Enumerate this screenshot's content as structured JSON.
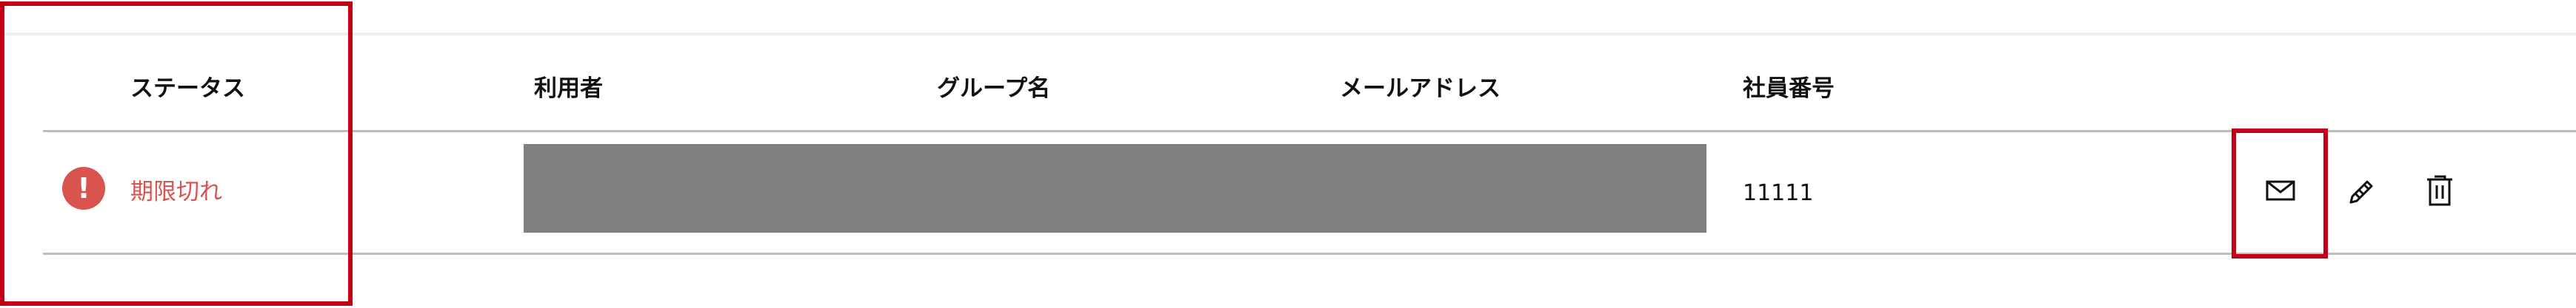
{
  "table": {
    "headers": [
      "ステータス",
      "利用者",
      "グループ名",
      "メールアドレス",
      "社員番号"
    ],
    "rows": [
      {
        "status": "期限切れ",
        "status_icon": "alert-circle-icon",
        "employee_number": "11111"
      }
    ]
  },
  "actions": {
    "items": [
      "mail-icon",
      "pencil-icon",
      "trash-icon"
    ]
  },
  "colors": {
    "status_expired": "#d9534f",
    "highlight": "#c40018",
    "redacted_fill": "#808080"
  },
  "icons": {
    "status_glyph": "!"
  }
}
